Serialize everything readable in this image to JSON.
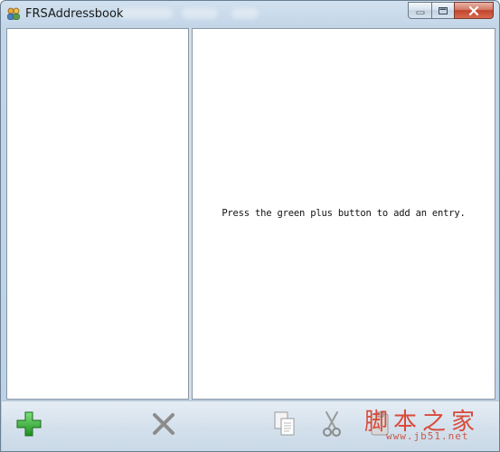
{
  "window": {
    "title": "FRSAddressbook"
  },
  "detail": {
    "hint": "Press the green plus button to add an entry."
  },
  "toolbar": {
    "buttons": [
      {
        "icon": "add-icon",
        "color": "#2fa52f"
      },
      {
        "icon": "delete-icon",
        "color": "#8a8a8a"
      },
      {
        "icon": "copy-icon",
        "color": "#8a8a8a"
      },
      {
        "icon": "cut-icon",
        "color": "#8a8a8a"
      },
      {
        "icon": "paste-icon",
        "color": "#8a8a8a"
      }
    ]
  },
  "watermark": {
    "text": "脚本之家",
    "url": "www.jb51.net"
  }
}
